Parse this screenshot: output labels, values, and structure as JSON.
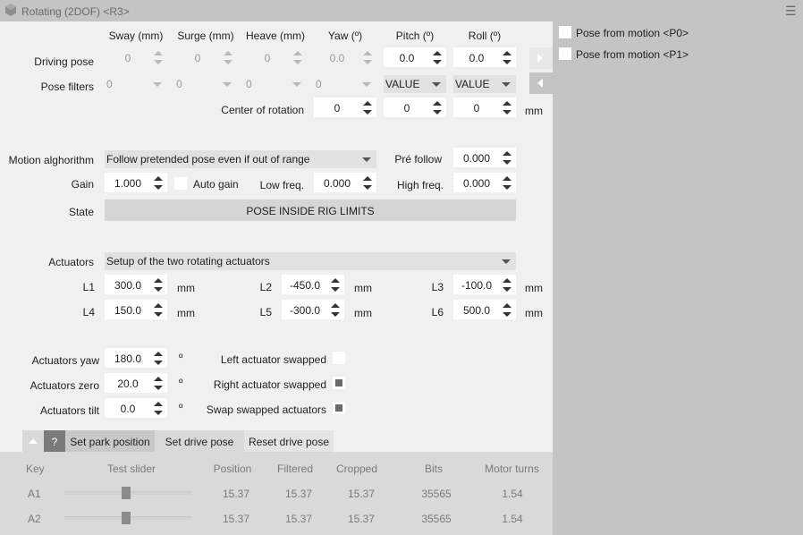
{
  "window": {
    "title": "Rotating (2DOF) <R3>",
    "menu_glyph": "☰"
  },
  "columns": [
    "Sway (mm)",
    "Surge (mm)",
    "Heave (mm)",
    "Yaw (º)",
    "Pitch (º)",
    "Roll (º)"
  ],
  "driving_pose": {
    "label": "Driving pose",
    "values": [
      "0",
      "0",
      "0",
      "0.0",
      "0.0",
      "0.0"
    ]
  },
  "pose_filters": {
    "label": "Pose filters",
    "values": [
      "0",
      "0",
      "0",
      "0",
      "VALUE",
      "VALUE"
    ]
  },
  "center_of_rotation": {
    "label": "Center of rotation",
    "values": [
      "0",
      "0",
      "0"
    ],
    "unit": "mm"
  },
  "side_options": [
    {
      "label": "Pose from motion <P0>",
      "checked": false
    },
    {
      "label": "Pose from motion <P1>",
      "checked": false
    }
  ],
  "motion": {
    "label": "Motion alghorithm",
    "value": "Follow pretended pose even if out of range",
    "pre_follow_label": "Pré follow",
    "pre_follow": "0.000",
    "gain_label": "Gain",
    "gain": "1.000",
    "auto_gain_label": "Auto gain",
    "low_freq_label": "Low freq.",
    "low_freq": "0.000",
    "high_freq_label": "High freq.",
    "high_freq": "0.000",
    "state_label": "State",
    "state": "POSE INSIDE RIG LIMITS"
  },
  "actuators": {
    "label": "Actuators",
    "setup": "Setup of the two rotating actuators",
    "unit": "mm",
    "lengths": [
      {
        "label": "L1",
        "value": "300.0"
      },
      {
        "label": "L2",
        "value": "-450.0"
      },
      {
        "label": "L3",
        "value": "-100.0"
      },
      {
        "label": "L4",
        "value": "150.0"
      },
      {
        "label": "L5",
        "value": "-300.0"
      },
      {
        "label": "L6",
        "value": "500.0"
      }
    ],
    "angle_unit": "º",
    "yaw_label": "Actuators yaw",
    "yaw": "180.0",
    "zero_label": "Actuators zero",
    "zero": "20.0",
    "tilt_label": "Actuators tilt",
    "tilt": "0.0",
    "left_swapped_label": "Left actuator swapped",
    "left_swapped": false,
    "right_swapped_label": "Right actuator swapped",
    "right_swapped": true,
    "swap_swapped_label": "Swap swapped actuators",
    "swap_swapped": true
  },
  "toolbar": {
    "help": "?",
    "park": "Set park position",
    "drive": "Set drive pose",
    "reset": "Reset drive pose"
  },
  "table": {
    "headers": [
      "Key",
      "Test slider",
      "Position",
      "Filtered",
      "Cropped",
      "Bits",
      "Motor turns"
    ],
    "rows": [
      {
        "key": "A1",
        "slider": 0.5,
        "position": "15.37",
        "filtered": "15.37",
        "cropped": "15.37",
        "bits": "35565",
        "turns": "1.54"
      },
      {
        "key": "A2",
        "slider": 0.5,
        "position": "15.37",
        "filtered": "15.37",
        "cropped": "15.37",
        "bits": "35565",
        "turns": "1.54"
      }
    ]
  },
  "colors": {
    "panel": "#f0f0f0",
    "frame": "#c4c4c4",
    "table_bg": "#d9d9d9"
  }
}
